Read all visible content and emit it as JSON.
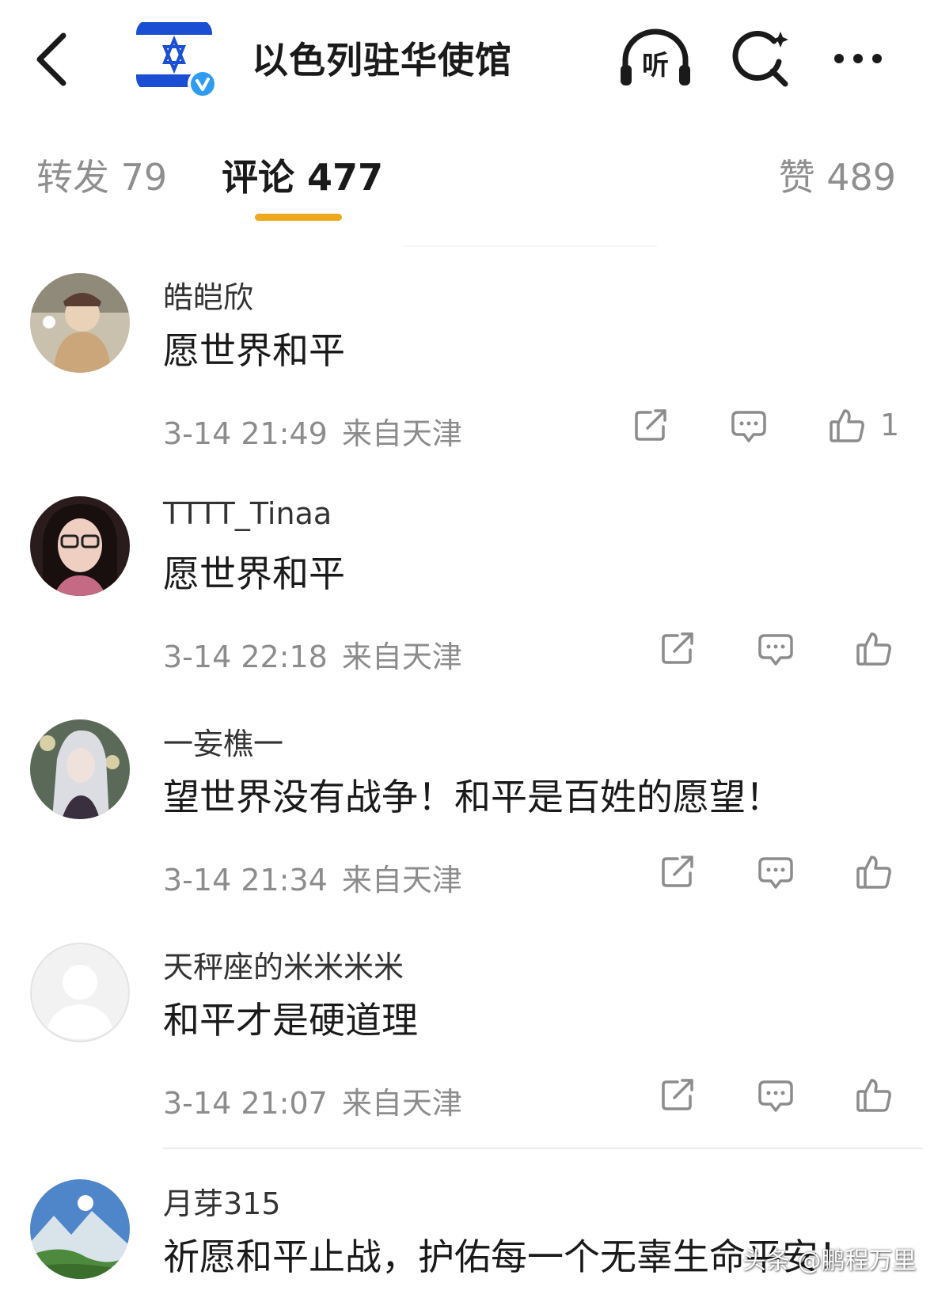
{
  "header": {
    "title": "以色列驻华使馆",
    "listen_label": "听",
    "icons": [
      "back-arrow-icon",
      "israel-flag-avatar",
      "verified-badge-icon",
      "headphones-icon",
      "search-spark-icon",
      "more-dots-icon"
    ]
  },
  "tabs": {
    "repost": "转发 79",
    "comment": "评论 477",
    "like": "赞 489",
    "active": "comment",
    "accent_color": "#f0a81e"
  },
  "comments": [
    {
      "username": "皓皑欣",
      "text": "愿世界和平",
      "time": "3-14 21:49",
      "location": "来自天津",
      "likes": "1"
    },
    {
      "username": "TTTT_Tinaa",
      "text": "愿世界和平",
      "time": "3-14 22:18",
      "location": "来自天津",
      "likes": ""
    },
    {
      "username": "一妄樵一",
      "text": "望世界没有战争！和平是百姓的愿望！",
      "time": "3-14 21:34",
      "location": "来自天津",
      "likes": ""
    },
    {
      "username": "天秤座的米米米米",
      "text": "和平才是硬道理",
      "time": "3-14 21:07",
      "location": "来自天津",
      "likes": ""
    },
    {
      "username": "月芽315",
      "text": "祈愿和平止战，护佑每一个无辜生命平安！"
    }
  ],
  "watermark": "头条 @鹏程万里",
  "colors": {
    "text_primary": "#1a1a1a",
    "text_secondary": "#8c8c8c",
    "flag_blue": "#1a4fd3",
    "verified_blue": "#2f9cf2"
  }
}
